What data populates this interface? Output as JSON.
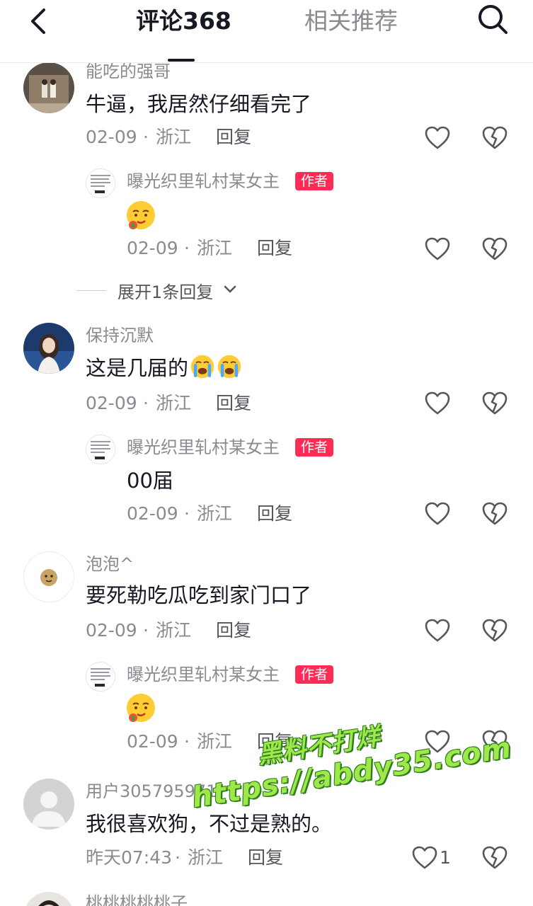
{
  "header": {
    "active_tab": "评论368",
    "inactive_tab": "相关推荐"
  },
  "comments": [
    {
      "username": "能吃的强哥",
      "text": "牛逼，我居然仔细看完了",
      "date": "02-09",
      "sep": "·",
      "location": "浙江",
      "reply_label": "回复",
      "reply": {
        "username": "曝光织里轧村某女主",
        "badge": "作者",
        "emoji": "drooling-face",
        "date": "02-09",
        "sep": "·",
        "location": "浙江",
        "reply_label": "回复"
      },
      "expand_label": "展开1条回复"
    },
    {
      "username": "保持沉默",
      "text": "这是几届的",
      "emoji": "crying-face",
      "date": "02-09",
      "sep": "·",
      "location": "浙江",
      "reply_label": "回复",
      "reply": {
        "username": "曝光织里轧村某女主",
        "badge": "作者",
        "text": "00届",
        "date": "02-09",
        "sep": "·",
        "location": "浙江",
        "reply_label": "回复"
      }
    },
    {
      "username": "泡泡^",
      "text": "要死勒吃瓜吃到家门口了",
      "date": "02-09",
      "sep": "·",
      "location": "浙江",
      "reply_label": "回复",
      "reply": {
        "username": "曝光织里轧村某女主",
        "badge": "作者",
        "emoji": "drooling-face",
        "date": "02-09",
        "sep": "·",
        "location": "浙江",
        "reply_label": "回复"
      }
    },
    {
      "username": "用户305795971",
      "text": "我很喜欢狗，不过是熟的。",
      "date": "昨天07:43",
      "sep": "·",
      "location": "浙江",
      "reply_label": "回复",
      "like_count": "1"
    },
    {
      "username": "桃桃桃桃桃子"
    }
  ],
  "watermark": {
    "line1": "黑料不打烊",
    "line2": "https://abdy35.com"
  },
  "colors": {
    "author_badge": "#fe2c55",
    "watermark": "#9fe84a"
  }
}
